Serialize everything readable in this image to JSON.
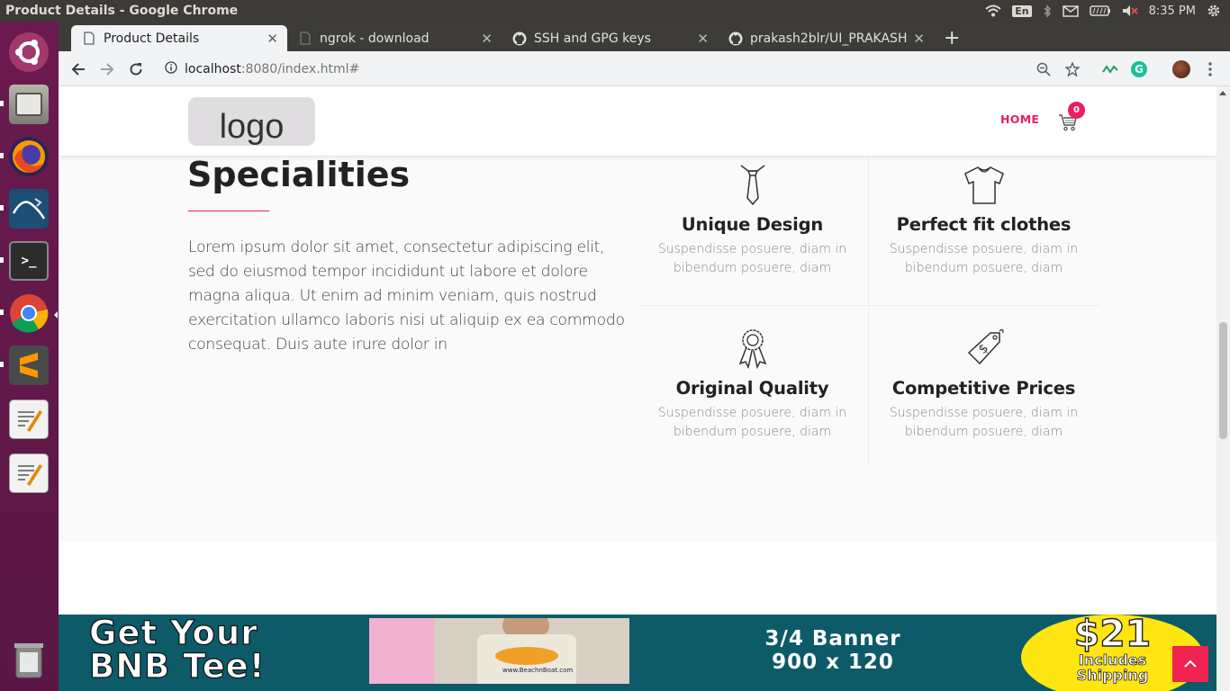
{
  "system": {
    "window_title": "Product Details - Google Chrome",
    "input_lang": "En",
    "clock": "8:35 PM"
  },
  "launcher": {
    "apps": [
      "ubuntu-dash-icon",
      "files-icon",
      "firefox-icon",
      "mysql-workbench-icon",
      "terminal-icon",
      "chrome-icon",
      "sublime-text-icon",
      "text-editor-icon",
      "text-editor-icon",
      "trash-icon"
    ]
  },
  "browser": {
    "tabs": [
      {
        "label": "Product Details",
        "active": true
      },
      {
        "label": "ngrok - download",
        "active": false
      },
      {
        "label": "SSH and GPG keys",
        "active": false
      },
      {
        "label": "prakash2blr/UI_PRAKASH",
        "active": false
      }
    ],
    "new_tab_label": "+",
    "url_host": "localhost",
    "url_path": ":8080/index.html#"
  },
  "site": {
    "logo_text": "logo",
    "nav_home": "HOME",
    "cart_count": "0",
    "accent_color": "#e91e63",
    "specialities": {
      "title": "Specialities",
      "body": "Lorem ipsum dolor sit amet, consectetur adipiscing elit, sed do eiusmod tempor incididunt ut labore et dolore magna aliqua. Ut enim ad minim veniam, quis nostrud exercitation ullamco laboris nisi ut aliquip ex ea commodo consequat. Duis aute irure dolor in"
    },
    "features": [
      {
        "icon": "tie-icon",
        "title": "Unique Design",
        "desc": "Suspendisse posuere, diam in bibendum posuere, diam"
      },
      {
        "icon": "tshirt-icon",
        "title": "Perfect fit clothes",
        "desc": "Suspendisse posuere, diam in bibendum posuere, diam"
      },
      {
        "icon": "award-ribbon-icon",
        "title": "Original Quality",
        "desc": "Suspendisse posuere, diam in bibendum posuere, diam"
      },
      {
        "icon": "price-tag-icon",
        "title": "Competitive Prices",
        "desc": "Suspendisse posuere, diam in bibendum posuere, diam"
      }
    ],
    "banner": {
      "line1": "Get Your",
      "line2": "BNB Tee!",
      "dims_line1": "3/4 Banner",
      "dims_line2": "900 x 120",
      "price": "$21",
      "price_note1": "Includes",
      "price_note2": "Shipping",
      "shirt_text": "www.BeachnBoat.com"
    }
  }
}
